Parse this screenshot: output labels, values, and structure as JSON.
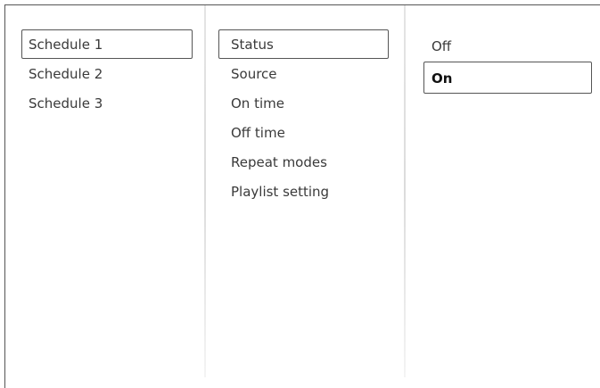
{
  "schedules": {
    "items": [
      {
        "label": "Schedule 1",
        "selected": true
      },
      {
        "label": "Schedule 2",
        "selected": false
      },
      {
        "label": "Schedule 3",
        "selected": false
      }
    ]
  },
  "settings": {
    "items": [
      {
        "label": "Status",
        "selected": true
      },
      {
        "label": "Source",
        "selected": false
      },
      {
        "label": "On time",
        "selected": false
      },
      {
        "label": "Off time",
        "selected": false
      },
      {
        "label": "Repeat modes",
        "selected": false
      },
      {
        "label": "Playlist setting",
        "selected": false
      }
    ]
  },
  "status_options": {
    "items": [
      {
        "label": "Off",
        "selected": false
      },
      {
        "label": "On",
        "selected": true
      }
    ]
  }
}
